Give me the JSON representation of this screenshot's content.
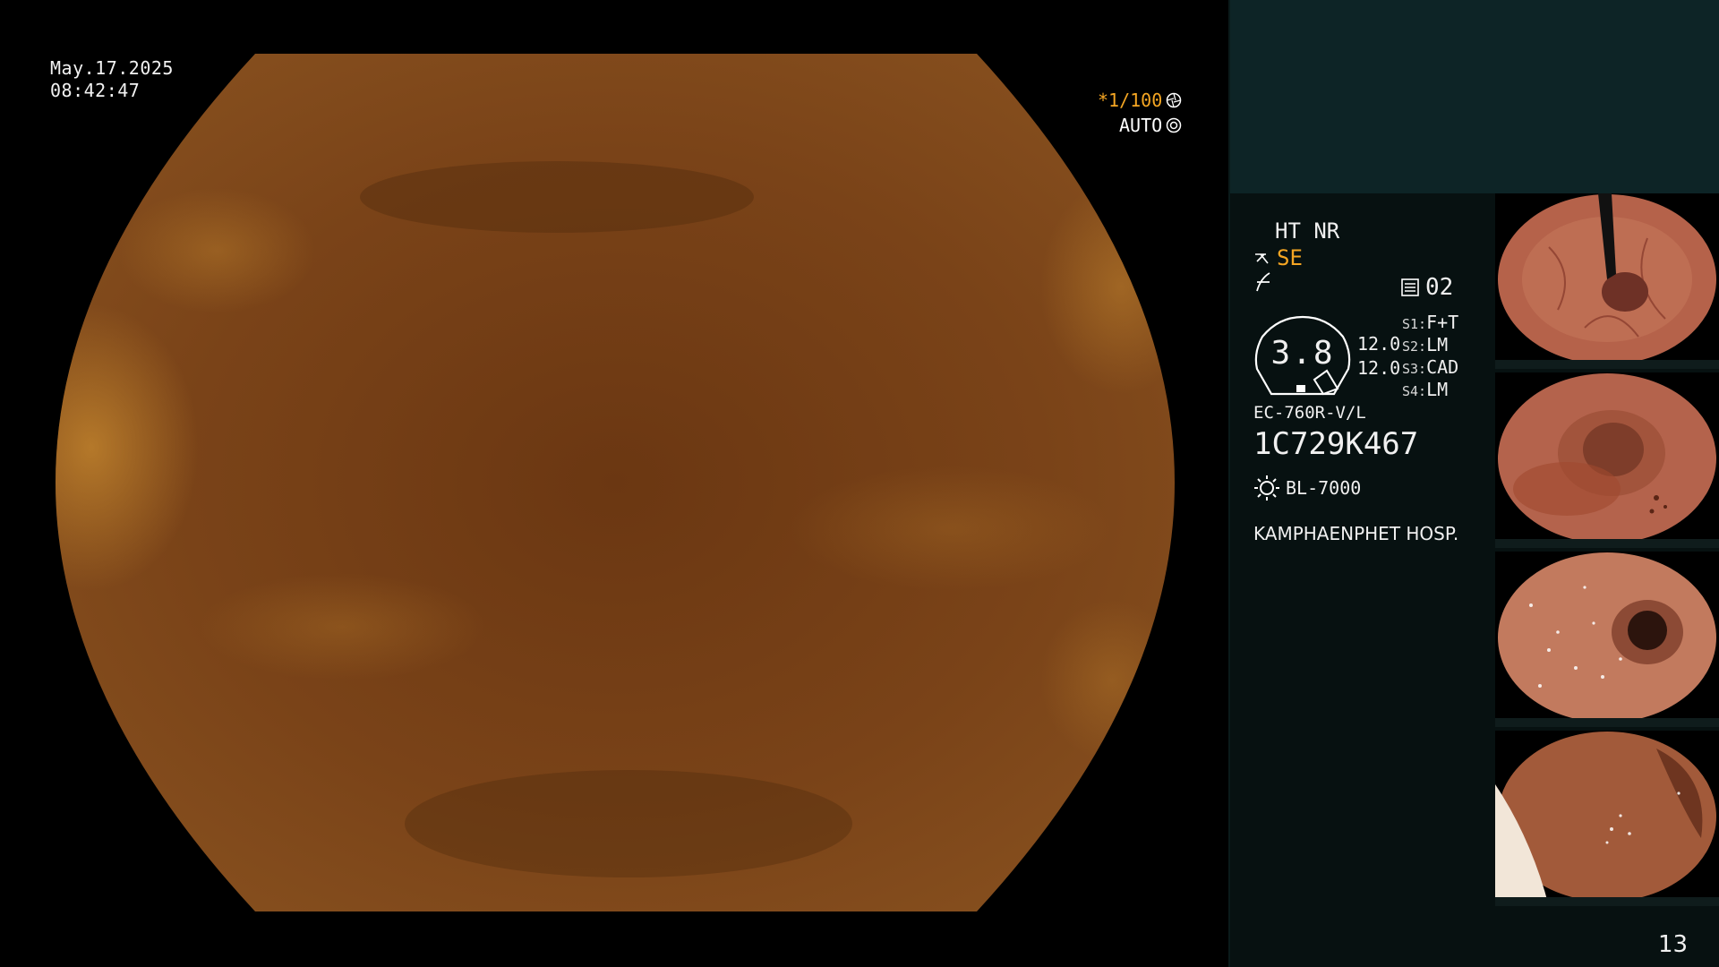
{
  "overlay": {
    "date": "May.17.2025",
    "time": "08:42:47",
    "shutter": "*1/100",
    "iris_mode": "AUTO"
  },
  "panel": {
    "ht_nr": "HT NR",
    "se": "SE",
    "memo_count": "02",
    "gauge_value": "3.8",
    "value_a": "12.0",
    "value_b": "12.0",
    "switches": [
      {
        "key": "S1:",
        "value": "F+T"
      },
      {
        "key": "S2:",
        "value": "LM"
      },
      {
        "key": "S3:",
        "value": "CAD"
      },
      {
        "key": "S4:",
        "value": "LM"
      }
    ],
    "scope_model": "EC-760R-V/L",
    "serial": "1C729K467",
    "light_source": "BL-7000",
    "hospital": "KAMPHAENPHET HOSP.",
    "page_number": "13"
  },
  "thumbnails": [
    {
      "name": "thumbnail-1",
      "tone": "#b5624a"
    },
    {
      "name": "thumbnail-2",
      "tone": "#b4634c"
    },
    {
      "name": "thumbnail-3",
      "tone": "#c27a5e"
    },
    {
      "name": "thumbnail-4",
      "tone": "#a25a3a"
    }
  ],
  "icons": {
    "shutter": "shutter-icon",
    "iris": "iris-icon",
    "scissors": "scissors-icon",
    "memo": "memo-icon",
    "light": "light-source-icon",
    "f-mark": "function-icon"
  },
  "colors": {
    "accent": "#f5a623",
    "panel_top": "#0d2426",
    "panel_bg": "#071111",
    "scope_fluid": "#7a4418"
  }
}
